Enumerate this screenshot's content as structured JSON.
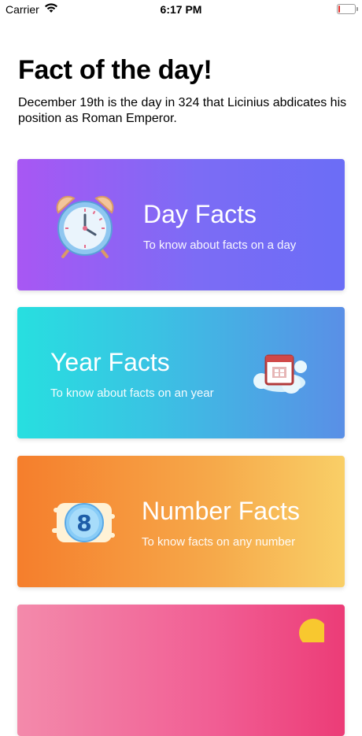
{
  "status_bar": {
    "carrier": "Carrier",
    "time": "6:17 PM",
    "battery_level": 0.05
  },
  "header": {
    "title": "Fact of the day!",
    "fact": "December 19th is the day in 324 that Licinius abdicates his position as Roman Emperor."
  },
  "cards": [
    {
      "title": "Day Facts",
      "subtitle": "To know about facts on a day",
      "icon": "alarm-clock-icon",
      "color": "#8c63f5"
    },
    {
      "title": "Year Facts",
      "subtitle": "To know about facts on an year",
      "icon": "calendar-cloud-icon",
      "color": "#3fb6e3"
    },
    {
      "title": "Number Facts",
      "subtitle": "To know facts on any number",
      "icon": "number-eight-icon",
      "color": "#f6a444"
    },
    {
      "icon": "partial-icon",
      "color": "#ef5a8f"
    }
  ],
  "number_icon_digit": "8"
}
